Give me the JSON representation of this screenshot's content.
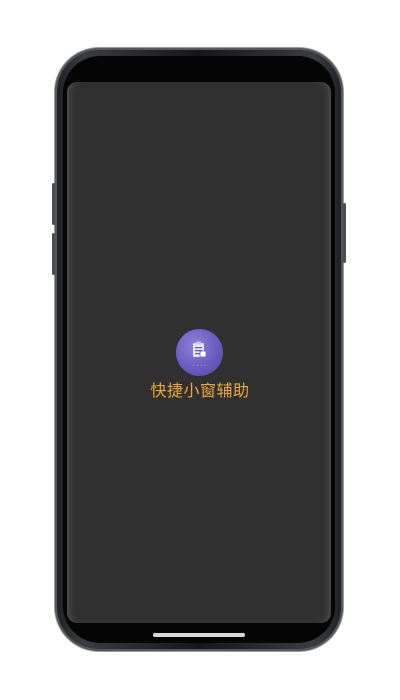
{
  "splash": {
    "app_name": "快捷小窗辅助",
    "accent_color": "#f0a63a",
    "icon": {
      "name": "clipboard-window-icon",
      "background_color": "#6a5bbf"
    }
  }
}
